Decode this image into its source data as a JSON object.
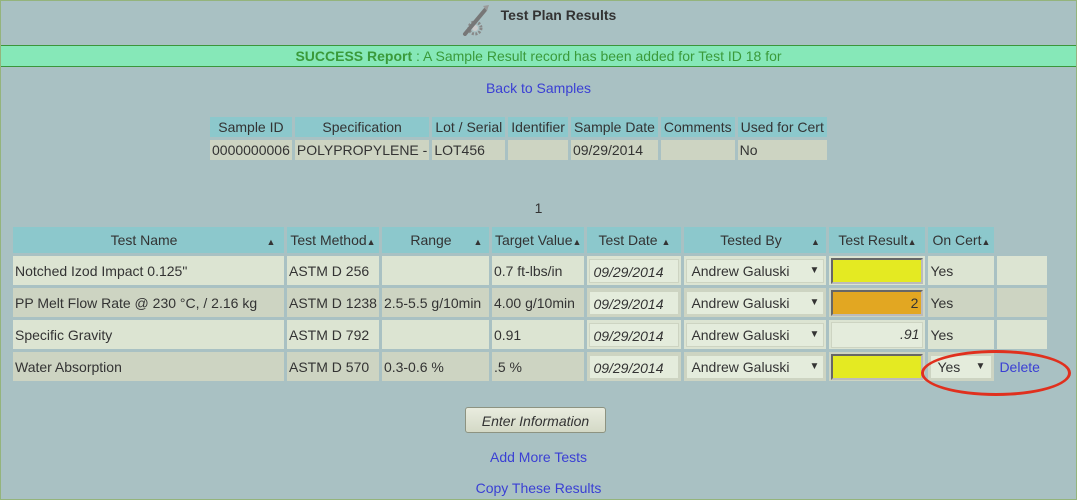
{
  "header": {
    "title": "Test Plan Results",
    "icon": "wrench-gear-icon"
  },
  "success": {
    "label": "SUCCESS Report",
    "message": " : A Sample Result record has been added for Test ID 18 for"
  },
  "links": {
    "back": "Back to Samples",
    "add_more": "Add More Tests",
    "copy": "Copy These Results"
  },
  "sample_table": {
    "headers": [
      "Sample ID",
      "Specification",
      "Lot / Serial",
      "Identifier",
      "Sample Date",
      "Comments",
      "Used for Cert"
    ],
    "row": [
      "0000000006",
      "POLYPROPYLENE -",
      "LOT456",
      "",
      "09/29/2014",
      "",
      "No"
    ]
  },
  "page_number": "1",
  "results_table": {
    "headers": [
      "Test Name",
      "Test Method",
      "Range",
      "Target Value",
      "Test Date",
      "Tested By",
      "Test Result",
      "On Cert"
    ],
    "sort_icon": "▲",
    "rows": [
      {
        "test_name": "Notched Izod Impact 0.125\"",
        "method": "ASTM D 256",
        "range": "",
        "target": "0.7 ft-lbs/in",
        "date": "09/29/2014",
        "tested_by": "Andrew Galuski",
        "result": "",
        "result_color": "#e4ea22",
        "on_cert": "Yes"
      },
      {
        "test_name": "PP Melt Flow Rate @ 230 °C, / 2.16 kg",
        "method": "ASTM D 1238",
        "range": "2.5-5.5 g/10min",
        "target": "4.00 g/10min",
        "date": "09/29/2014",
        "tested_by": "Andrew Galuski",
        "result": "2",
        "result_color": "#e2a722",
        "on_cert": "Yes"
      },
      {
        "test_name": "Specific Gravity",
        "method": "ASTM D 792",
        "range": "",
        "target": "0.91",
        "date": "09/29/2014",
        "tested_by": "Andrew Galuski",
        "result": ".91",
        "result_color": "#e4ecdc",
        "on_cert": "Yes"
      },
      {
        "test_name": "Water Absorption",
        "method": "ASTM D 570",
        "range": "0.3-0.6 %",
        "target": ".5 %",
        "date": "09/29/2014",
        "tested_by": "Andrew Galuski",
        "result": "",
        "result_color": "#e4ea22",
        "on_cert_select": "Yes",
        "delete_label": "Delete"
      }
    ]
  },
  "buttons": {
    "enter": "Enter Information"
  }
}
